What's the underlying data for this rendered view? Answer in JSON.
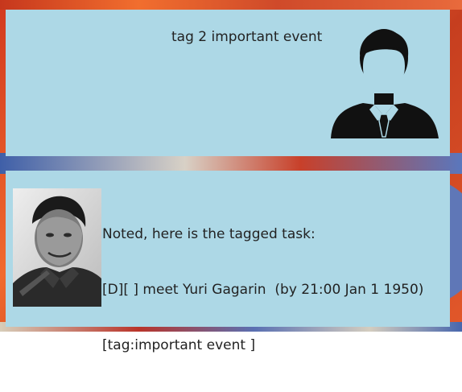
{
  "user_message": {
    "text": "tag 2 important event",
    "avatar_icon": "person-silhouette-icon"
  },
  "bot_message": {
    "lines": [
      "Noted, here is the tagged task:",
      "[D][ ] meet Yuri Gagarin  (by 21:00 Jan 1 1950)",
      "[tag:important event ]"
    ],
    "avatar_icon": "portrait-photo"
  },
  "colors": {
    "bubble": "#add8e6",
    "text": "#222222"
  }
}
